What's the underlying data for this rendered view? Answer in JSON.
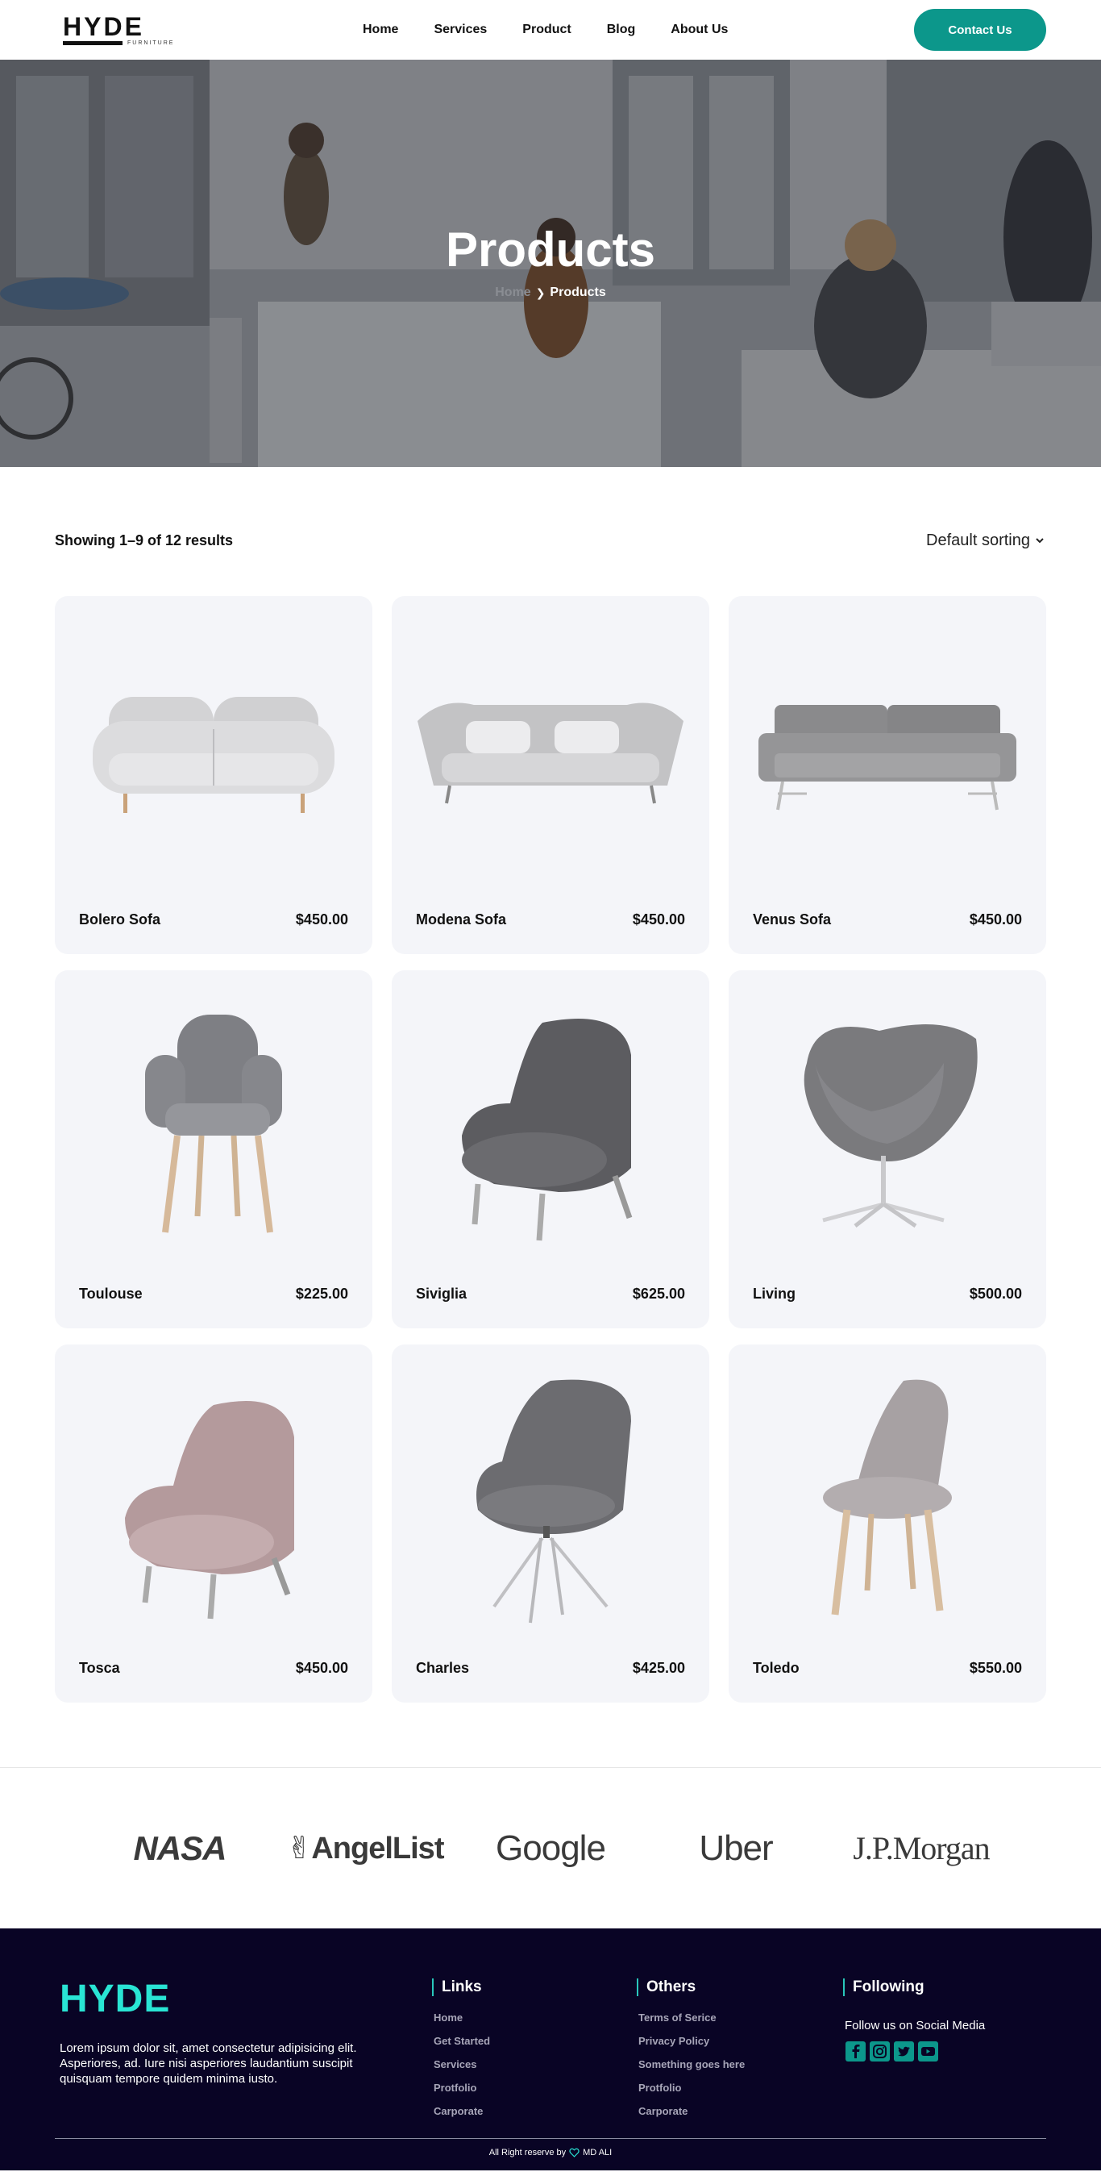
{
  "header": {
    "logo_text": "HYDE",
    "logo_sub": "FURNITURE",
    "nav": [
      "Home",
      "Services",
      "Product",
      "Blog",
      "About Us"
    ],
    "contact_label": "Contact Us"
  },
  "hero": {
    "title": "Products",
    "breadcrumb_home": "Home",
    "breadcrumb_current": "Products"
  },
  "toolbar": {
    "result_count": "Showing 1–9 of 12 results",
    "sorting": "Default sorting"
  },
  "products": [
    {
      "name": "Bolero Sofa",
      "price": "$450.00",
      "image": "sofa-rounded-light-gray"
    },
    {
      "name": "Modena Sofa",
      "price": "$450.00",
      "image": "sofa-curved-with-cushions"
    },
    {
      "name": "Venus Sofa",
      "price": "$450.00",
      "image": "sofa-modern-gray"
    },
    {
      "name": "Toulouse",
      "price": "$225.00",
      "image": "chair-gray-wood-legs"
    },
    {
      "name": "Siviglia",
      "price": "$625.00",
      "image": "lounge-chair-dark-gray"
    },
    {
      "name": "Living",
      "price": "$500.00",
      "image": "swan-chair-gray"
    },
    {
      "name": "Tosca",
      "price": "$450.00",
      "image": "lounge-chair-pink"
    },
    {
      "name": "Charles",
      "price": "$425.00",
      "image": "chair-gray-chrome-legs"
    },
    {
      "name": "Toledo",
      "price": "$550.00",
      "image": "chair-beige-wood-legs"
    }
  ],
  "partners": [
    "NASA",
    "AngelList",
    "Google",
    "Uber",
    "J.P.Morgan"
  ],
  "footer": {
    "logo": "HYDE",
    "description": "Lorem ipsum dolor sit, amet consectetur adipisicing elit. Asperiores, ad. Iure nisi asperiores laudantium suscipit quisquam tempore quidem minima iusto.",
    "links_title": "Links",
    "links": [
      "Home",
      "Get Started",
      "Services",
      "Protfolio",
      "Carporate"
    ],
    "others_title": "Others",
    "others": [
      "Terms of Serice",
      "Privacy Policy",
      "Something goes here",
      "Protfolio",
      "Carporate"
    ],
    "following_title": "Following",
    "follow_text": "Follow us on Social Media",
    "social_icons": [
      "facebook-icon",
      "instagram-icon",
      "twitter-icon",
      "youtube-icon"
    ],
    "copyright": "All Right reserve by",
    "author": "MD ALI"
  },
  "colors": {
    "accent": "#0c978b",
    "footer_bg": "#090425",
    "footer_logo": "#29e4d4",
    "card_bg": "#f4f5f9"
  }
}
